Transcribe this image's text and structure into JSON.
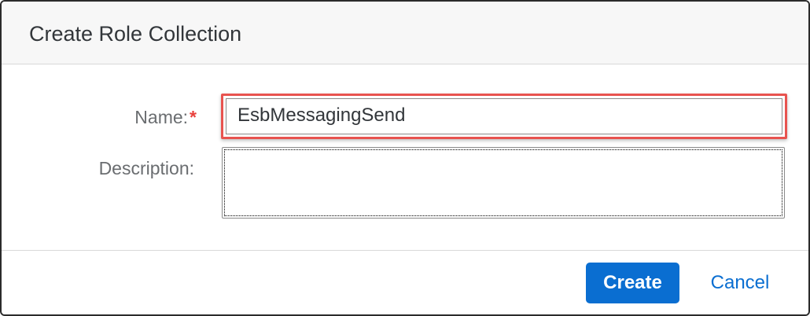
{
  "dialog": {
    "title": "Create Role Collection"
  },
  "form": {
    "name_label": "Name:",
    "required_marker": "*",
    "name_value": "EsbMessagingSend",
    "description_label": "Description:",
    "description_value": ""
  },
  "footer": {
    "create_label": "Create",
    "cancel_label": "Cancel"
  },
  "colors": {
    "primary": "#0a6ed1",
    "required": "#e9413d",
    "highlight": "#e8534f"
  }
}
